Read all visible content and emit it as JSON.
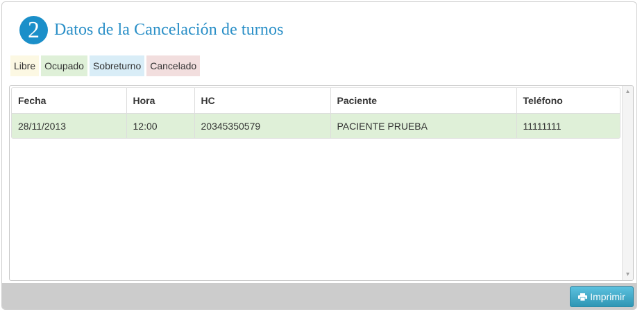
{
  "header": {
    "step_number": "2",
    "title": "Datos de la Cancelación de turnos"
  },
  "legend": {
    "libre": "Libre",
    "ocupado": "Ocupado",
    "sobreturno": "Sobreturno",
    "cancelado": "Cancelado"
  },
  "colors": {
    "libre": "#fcf8e3",
    "ocupado": "#dff0d8",
    "sobreturno": "#d9edf7",
    "cancelado": "#f2dede",
    "accent": "#1b8fc9"
  },
  "table": {
    "columns": [
      "Fecha",
      "Hora",
      "HC",
      "Paciente",
      "Teléfono"
    ],
    "rows": [
      [
        "28/11/2013",
        "12:00",
        "20345350579",
        "PACIENTE PRUEBA",
        "11111111"
      ]
    ]
  },
  "footer": {
    "print_label": "Imprimir",
    "print_icon": "printer-icon"
  }
}
